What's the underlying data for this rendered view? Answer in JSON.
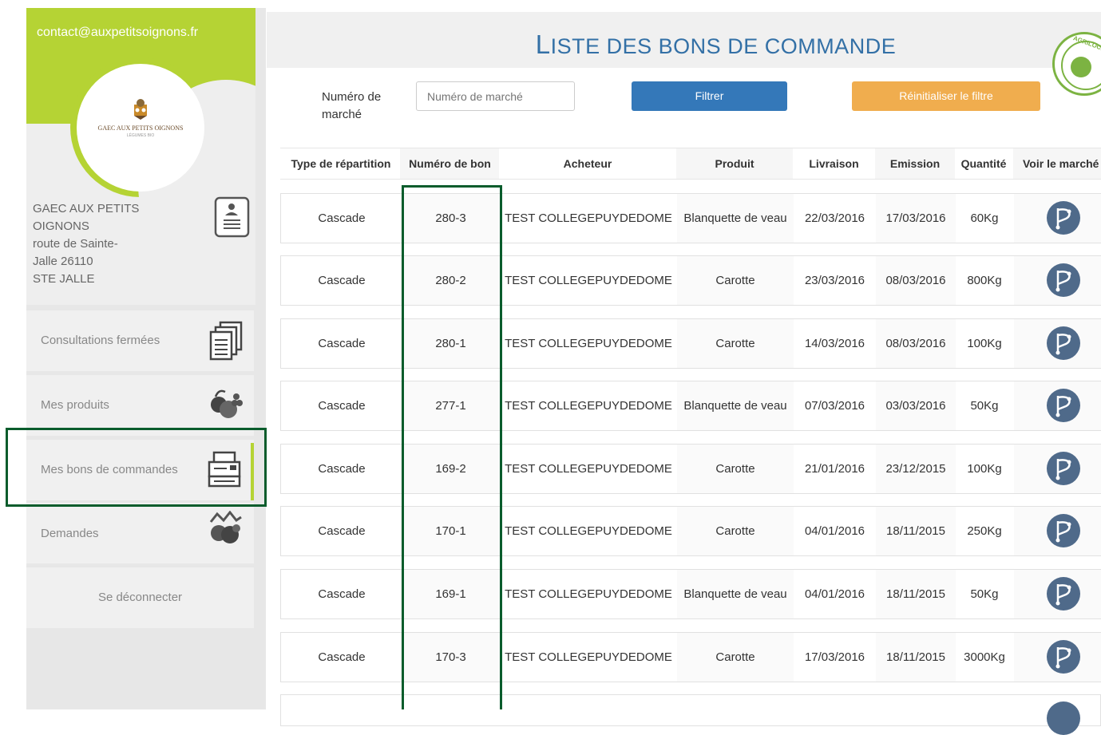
{
  "sidebar": {
    "email": "contact@auxpetitsoignons.fr",
    "logo_text": "GAEC AUX PETITS OIGNONS",
    "address_lines": [
      "GAEC AUX PETITS",
      "OIGNONS",
      "route de Sainte-",
      "Jalle 26110",
      "STE JALLE"
    ],
    "menu": [
      {
        "label": "Consultations fermées",
        "icon": "documents-icon"
      },
      {
        "label": "Mes produits",
        "icon": "fruits-vegetables-icon"
      },
      {
        "label": "Mes bons de commandes",
        "icon": "cash-register-icon",
        "active": true
      },
      {
        "label": "Demandes",
        "icon": "produce-basket-icon"
      }
    ],
    "logout": "Se déconnecter"
  },
  "header": {
    "title_first_letter": "L",
    "title_rest": "ISTE DES BONS DE COMMANDE"
  },
  "filter": {
    "label": "Numéro de marché",
    "input_placeholder": "Numéro de marché",
    "filter_button": "Filtrer",
    "reset_button": "Réinitialiser le filtre"
  },
  "table": {
    "columns": [
      "Type de répartition",
      "Numéro de bon",
      "Acheteur",
      "Produit",
      "Livraison",
      "Emission",
      "Quantité",
      "Voir le marché"
    ],
    "rows": [
      {
        "type": "Cascade",
        "bon": "280-3",
        "acheteur": "TEST COLLEGEPUYDEDOME",
        "produit": "Blanquette de veau",
        "livraison": "22/03/2016",
        "emission": "17/03/2016",
        "quantite": "60Kg"
      },
      {
        "type": "Cascade",
        "bon": "280-2",
        "acheteur": "TEST COLLEGEPUYDEDOME",
        "produit": "Carotte",
        "livraison": "23/03/2016",
        "emission": "08/03/2016",
        "quantite": "800Kg"
      },
      {
        "type": "Cascade",
        "bon": "280-1",
        "acheteur": "TEST COLLEGEPUYDEDOME",
        "produit": "Carotte",
        "livraison": "14/03/2016",
        "emission": "08/03/2016",
        "quantite": "100Kg"
      },
      {
        "type": "Cascade",
        "bon": "277-1",
        "acheteur": "TEST COLLEGEPUYDEDOME",
        "produit": "Blanquette de veau",
        "livraison": "07/03/2016",
        "emission": "03/03/2016",
        "quantite": "50Kg"
      },
      {
        "type": "Cascade",
        "bon": "169-2",
        "acheteur": "TEST COLLEGEPUYDEDOME",
        "produit": "Carotte",
        "livraison": "21/01/2016",
        "emission": "23/12/2015",
        "quantite": "100Kg"
      },
      {
        "type": "Cascade",
        "bon": "170-1",
        "acheteur": "TEST COLLEGEPUYDEDOME",
        "produit": "Carotte",
        "livraison": "04/01/2016",
        "emission": "18/11/2015",
        "quantite": "250Kg"
      },
      {
        "type": "Cascade",
        "bon": "169-1",
        "acheteur": "TEST COLLEGEPUYDEDOME",
        "produit": "Blanquette de veau",
        "livraison": "04/01/2016",
        "emission": "18/11/2015",
        "quantite": "50Kg"
      },
      {
        "type": "Cascade",
        "bon": "170-3",
        "acheteur": "TEST COLLEGEPUYDEDOME",
        "produit": "Carotte",
        "livraison": "17/03/2016",
        "emission": "18/11/2015",
        "quantite": "3000Kg"
      }
    ]
  },
  "colors": {
    "brand_green": "#b5d334",
    "title_blue": "#3370a6",
    "button_blue": "#3478b9",
    "button_orange": "#f0ad4e",
    "highlight_green": "#0a5c2c"
  }
}
